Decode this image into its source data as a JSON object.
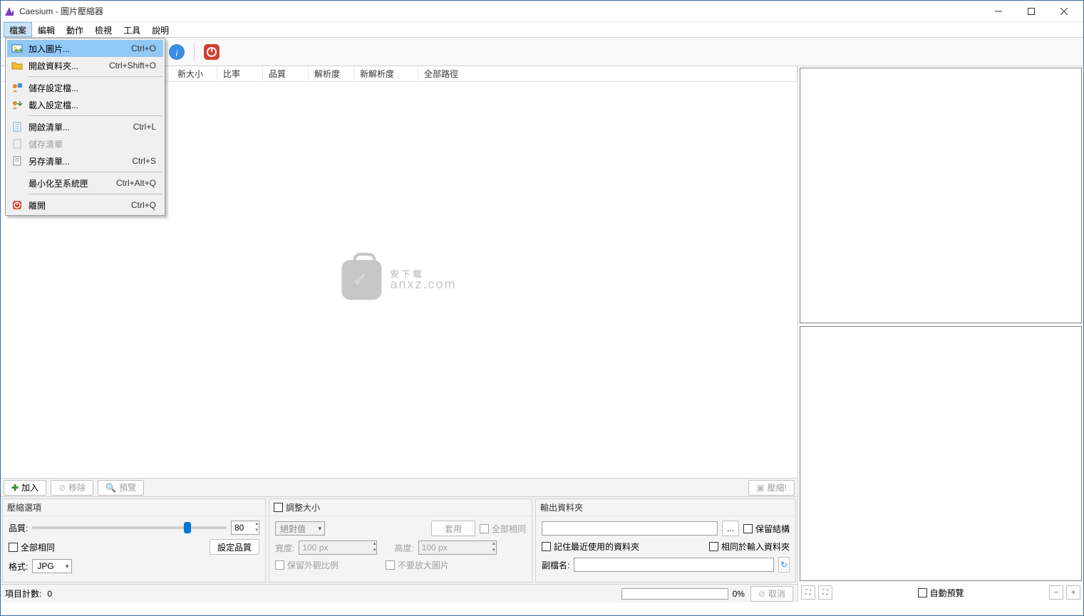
{
  "window": {
    "title": "Caesium - 圖片壓縮器"
  },
  "menubar": [
    "檔案",
    "編輯",
    "動作",
    "檢視",
    "工具",
    "說明"
  ],
  "file_menu": {
    "add_pictures": "加入圖片...",
    "open_folder": "開啟資料夾...",
    "save_profile": "儲存設定檔...",
    "load_profile": "載入設定檔...",
    "open_list": "開啟清單...",
    "save_list": "儲存清單",
    "save_list_as": "另存清單...",
    "minimize_tray": "最小化至系統匣",
    "exit": "離開",
    "sc_add": "Ctrl+O",
    "sc_open_folder": "Ctrl+Shift+O",
    "sc_open_list": "Ctrl+L",
    "sc_save_list_as": "Ctrl+S",
    "sc_minimize": "Ctrl+Alt+Q",
    "sc_exit": "Ctrl+Q"
  },
  "table_headers": [
    "新大小",
    "比率",
    "品質",
    "解析度",
    "新解析度",
    "全部路徑"
  ],
  "watermark": {
    "text": "安下载",
    "sub": "anxz.com"
  },
  "actions": {
    "add": "加入",
    "remove": "移除",
    "preview": "預覽",
    "compress": "壓縮!"
  },
  "compress_panel": {
    "title": "壓縮選項",
    "quality_label": "品質:",
    "quality_value": "80",
    "same_for_all": "全部相同",
    "set_quality": "設定品質",
    "format_label": "格式:",
    "format_value": "JPG"
  },
  "resize_panel": {
    "title": "調整大小",
    "mode": "絕對值",
    "apply": "套用",
    "same_for_all": "全部相同",
    "width_label": "寬度:",
    "width_value": "100 px",
    "height_label": "高度:",
    "height_value": "100 px",
    "keep_ratio": "保留外觀比例",
    "no_enlarge": "不要放大圖片"
  },
  "output_panel": {
    "title": "輸出資料夾",
    "browse": "...",
    "keep_structure": "保留結構",
    "remember_folder": "記住最近使用的資料夾",
    "same_as_input": "相同於輸入資料夾",
    "suffix_label": "副檔名:"
  },
  "bottom": {
    "progress_pct": "0%",
    "cancel": "取消"
  },
  "status": {
    "item_count_label": "項目計數:",
    "item_count_value": "0"
  },
  "right": {
    "auto_preview": "自動預覽"
  }
}
